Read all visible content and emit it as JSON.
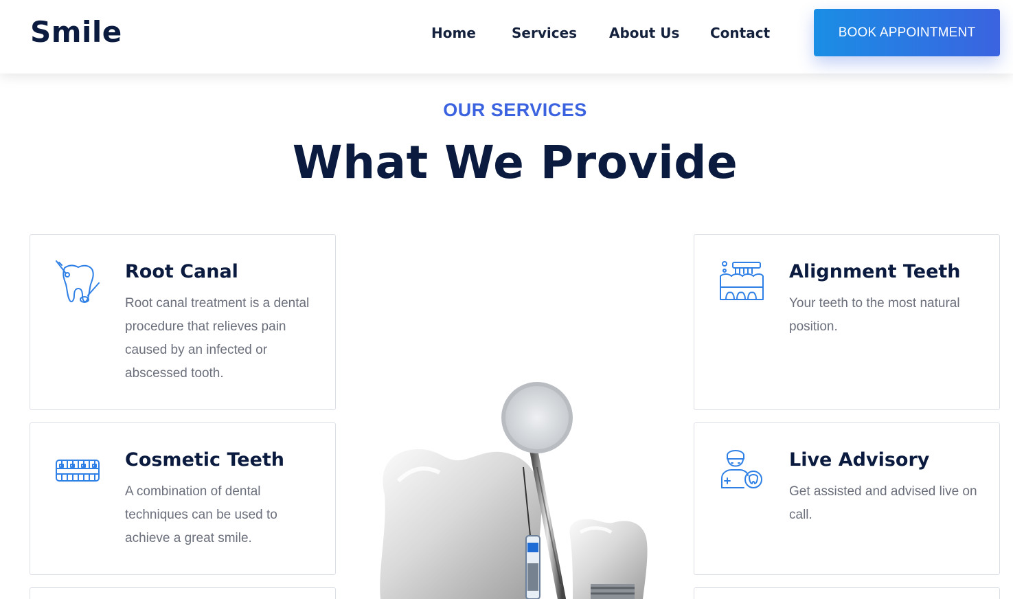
{
  "brand": {
    "name": "Smile",
    "accent": "#3b63e0",
    "navy": "#0b1b3f"
  },
  "nav": {
    "links": [
      "Home",
      "Services",
      "About Us",
      "Contact"
    ],
    "cta": "BOOK APPOINTMENT"
  },
  "section": {
    "eyebrow": "OUR SERVICES",
    "title": "What We Provide"
  },
  "services": {
    "root_canal": {
      "title": "Root Canal",
      "desc": "Root canal treatment is a dental procedure that relieves pain caused by an infected or abscessed tooth.",
      "icon": "tooth-dental-tools-icon"
    },
    "alignment": {
      "title": "Alignment Teeth",
      "desc": "Your teeth to the most natural position.",
      "icon": "toothbrush-teeth-icon"
    },
    "cosmetic": {
      "title": "Cosmetic Teeth",
      "desc": "A combination of dental techniques can be used to achieve a great smile.",
      "icon": "braces-teeth-icon"
    },
    "advisory": {
      "title": "Live Advisory",
      "desc": "Get assisted and advised live on call.",
      "icon": "dentist-advisor-icon"
    }
  },
  "hero_image": "tooth-mirror-syringe-illustration"
}
